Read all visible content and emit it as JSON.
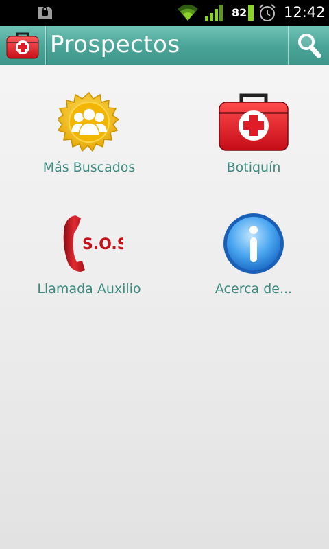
{
  "status_bar": {
    "battery_level": "82",
    "time": "12:42",
    "icons": [
      "sd-card-icon",
      "wifi-icon",
      "signal-icon",
      "battery-icon",
      "alarm-clock-icon"
    ]
  },
  "action_bar": {
    "title": "Prospectos",
    "logo_icon": "first-aid-kit-icon",
    "search_icon": "search-icon",
    "bg_color": "#49a497"
  },
  "grid": {
    "items": [
      {
        "label": "Más Buscados",
        "icon": "people-badge-icon"
      },
      {
        "label": "Botiquín",
        "icon": "first-aid-kit-icon"
      },
      {
        "label": "Llamada Auxilio",
        "icon": "sos-phone-icon"
      },
      {
        "label": "Acerca de...",
        "icon": "info-icon"
      }
    ],
    "label_color": "#3d8b80"
  }
}
